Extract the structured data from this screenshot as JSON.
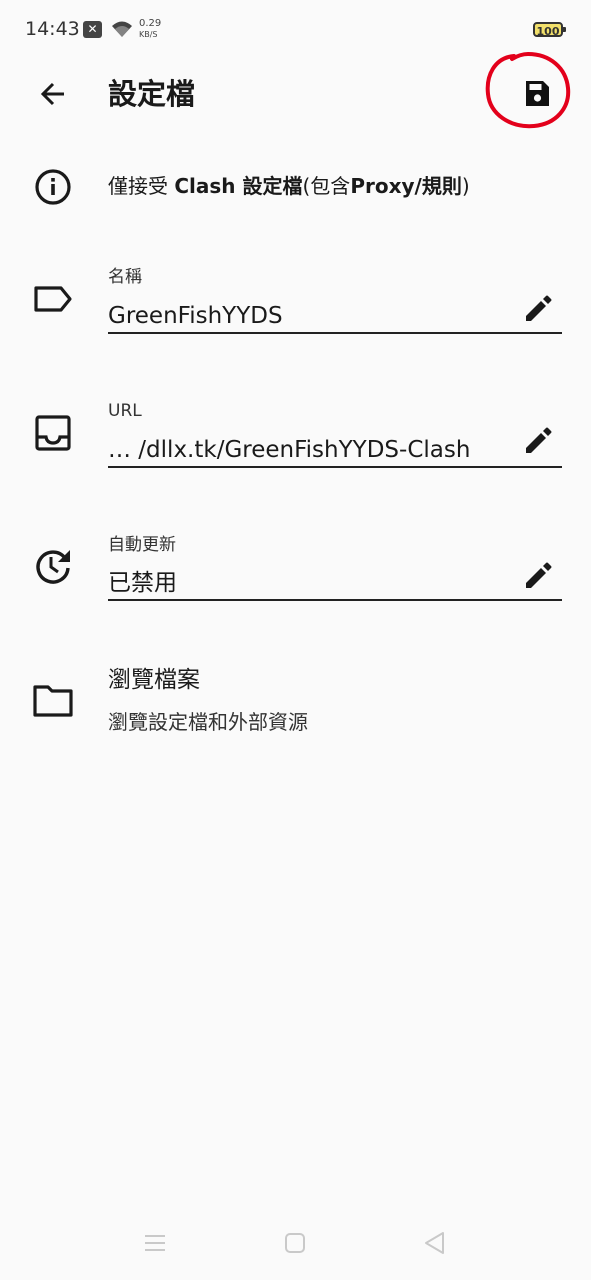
{
  "status_bar": {
    "time": "14:43",
    "net_speed_value": "0.29",
    "net_speed_unit": "KB/S",
    "battery": "100",
    "battery_color": "#f2e06b"
  },
  "app_bar": {
    "title": "設定檔",
    "back_icon": "arrow-left-icon",
    "save_icon": "floppy-disk-icon",
    "highlight_color": "#e3001b"
  },
  "info": {
    "text_pre": "僅接受 ",
    "text_bold1": "Clash 設定檔",
    "text_mid": "(包含",
    "text_bold2": "Proxy/規則",
    "text_post": ")"
  },
  "fields": {
    "name": {
      "label": "名稱",
      "value": "GreenFishYYDS"
    },
    "url": {
      "label": "URL",
      "value": "… /dllx.tk/GreenFishYYDS-Clash"
    },
    "auto_update": {
      "label": "自動更新",
      "value": "已禁用"
    }
  },
  "browse": {
    "title": "瀏覽檔案",
    "subtitle": "瀏覽設定檔和外部資源"
  }
}
